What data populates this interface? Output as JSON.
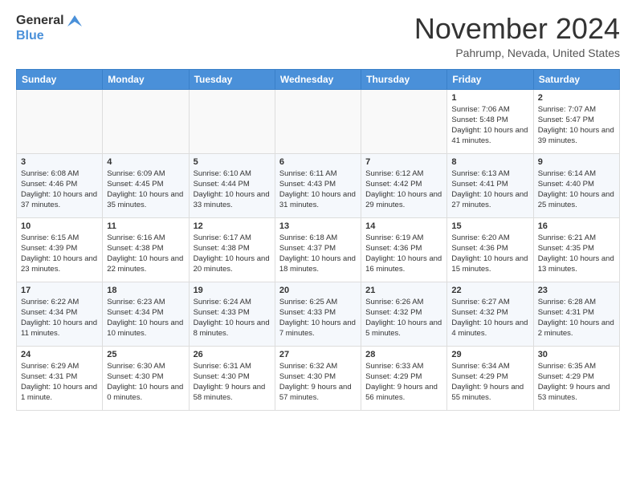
{
  "logo": {
    "line1": "General",
    "line2": "Blue"
  },
  "title": "November 2024",
  "location": "Pahrump, Nevada, United States",
  "days_of_week": [
    "Sunday",
    "Monday",
    "Tuesday",
    "Wednesday",
    "Thursday",
    "Friday",
    "Saturday"
  ],
  "weeks": [
    [
      {
        "day": "",
        "info": ""
      },
      {
        "day": "",
        "info": ""
      },
      {
        "day": "",
        "info": ""
      },
      {
        "day": "",
        "info": ""
      },
      {
        "day": "",
        "info": ""
      },
      {
        "day": "1",
        "info": "Sunrise: 7:06 AM\nSunset: 5:48 PM\nDaylight: 10 hours and 41 minutes."
      },
      {
        "day": "2",
        "info": "Sunrise: 7:07 AM\nSunset: 5:47 PM\nDaylight: 10 hours and 39 minutes."
      }
    ],
    [
      {
        "day": "3",
        "info": "Sunrise: 6:08 AM\nSunset: 4:46 PM\nDaylight: 10 hours and 37 minutes."
      },
      {
        "day": "4",
        "info": "Sunrise: 6:09 AM\nSunset: 4:45 PM\nDaylight: 10 hours and 35 minutes."
      },
      {
        "day": "5",
        "info": "Sunrise: 6:10 AM\nSunset: 4:44 PM\nDaylight: 10 hours and 33 minutes."
      },
      {
        "day": "6",
        "info": "Sunrise: 6:11 AM\nSunset: 4:43 PM\nDaylight: 10 hours and 31 minutes."
      },
      {
        "day": "7",
        "info": "Sunrise: 6:12 AM\nSunset: 4:42 PM\nDaylight: 10 hours and 29 minutes."
      },
      {
        "day": "8",
        "info": "Sunrise: 6:13 AM\nSunset: 4:41 PM\nDaylight: 10 hours and 27 minutes."
      },
      {
        "day": "9",
        "info": "Sunrise: 6:14 AM\nSunset: 4:40 PM\nDaylight: 10 hours and 25 minutes."
      }
    ],
    [
      {
        "day": "10",
        "info": "Sunrise: 6:15 AM\nSunset: 4:39 PM\nDaylight: 10 hours and 23 minutes."
      },
      {
        "day": "11",
        "info": "Sunrise: 6:16 AM\nSunset: 4:38 PM\nDaylight: 10 hours and 22 minutes."
      },
      {
        "day": "12",
        "info": "Sunrise: 6:17 AM\nSunset: 4:38 PM\nDaylight: 10 hours and 20 minutes."
      },
      {
        "day": "13",
        "info": "Sunrise: 6:18 AM\nSunset: 4:37 PM\nDaylight: 10 hours and 18 minutes."
      },
      {
        "day": "14",
        "info": "Sunrise: 6:19 AM\nSunset: 4:36 PM\nDaylight: 10 hours and 16 minutes."
      },
      {
        "day": "15",
        "info": "Sunrise: 6:20 AM\nSunset: 4:36 PM\nDaylight: 10 hours and 15 minutes."
      },
      {
        "day": "16",
        "info": "Sunrise: 6:21 AM\nSunset: 4:35 PM\nDaylight: 10 hours and 13 minutes."
      }
    ],
    [
      {
        "day": "17",
        "info": "Sunrise: 6:22 AM\nSunset: 4:34 PM\nDaylight: 10 hours and 11 minutes."
      },
      {
        "day": "18",
        "info": "Sunrise: 6:23 AM\nSunset: 4:34 PM\nDaylight: 10 hours and 10 minutes."
      },
      {
        "day": "19",
        "info": "Sunrise: 6:24 AM\nSunset: 4:33 PM\nDaylight: 10 hours and 8 minutes."
      },
      {
        "day": "20",
        "info": "Sunrise: 6:25 AM\nSunset: 4:33 PM\nDaylight: 10 hours and 7 minutes."
      },
      {
        "day": "21",
        "info": "Sunrise: 6:26 AM\nSunset: 4:32 PM\nDaylight: 10 hours and 5 minutes."
      },
      {
        "day": "22",
        "info": "Sunrise: 6:27 AM\nSunset: 4:32 PM\nDaylight: 10 hours and 4 minutes."
      },
      {
        "day": "23",
        "info": "Sunrise: 6:28 AM\nSunset: 4:31 PM\nDaylight: 10 hours and 2 minutes."
      }
    ],
    [
      {
        "day": "24",
        "info": "Sunrise: 6:29 AM\nSunset: 4:31 PM\nDaylight: 10 hours and 1 minute."
      },
      {
        "day": "25",
        "info": "Sunrise: 6:30 AM\nSunset: 4:30 PM\nDaylight: 10 hours and 0 minutes."
      },
      {
        "day": "26",
        "info": "Sunrise: 6:31 AM\nSunset: 4:30 PM\nDaylight: 9 hours and 58 minutes."
      },
      {
        "day": "27",
        "info": "Sunrise: 6:32 AM\nSunset: 4:30 PM\nDaylight: 9 hours and 57 minutes."
      },
      {
        "day": "28",
        "info": "Sunrise: 6:33 AM\nSunset: 4:29 PM\nDaylight: 9 hours and 56 minutes."
      },
      {
        "day": "29",
        "info": "Sunrise: 6:34 AM\nSunset: 4:29 PM\nDaylight: 9 hours and 55 minutes."
      },
      {
        "day": "30",
        "info": "Sunrise: 6:35 AM\nSunset: 4:29 PM\nDaylight: 9 hours and 53 minutes."
      }
    ]
  ]
}
